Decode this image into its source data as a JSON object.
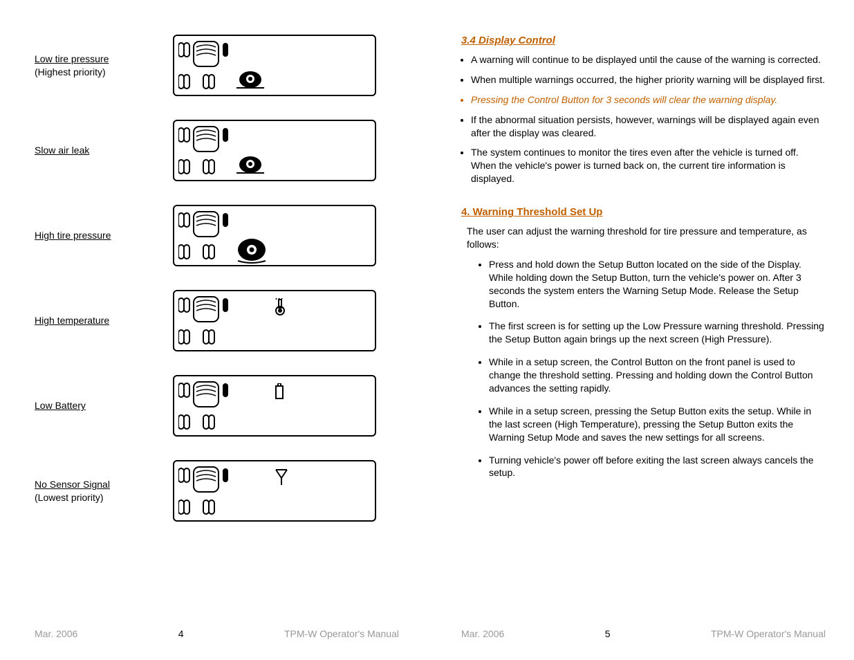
{
  "left_page": {
    "warnings": [
      {
        "title": "Low tire pressure",
        "sub": "(Highest priority)",
        "variant": "flat_tire"
      },
      {
        "title": "Slow air leak",
        "sub": "",
        "variant": "flat_tire"
      },
      {
        "title": "High tire pressure",
        "sub": "",
        "variant": "big_tire"
      },
      {
        "title": "High temperature",
        "sub": "",
        "variant": "thermometer"
      },
      {
        "title": "Low Battery",
        "sub": "",
        "variant": "battery"
      },
      {
        "title": "No Sensor Signal",
        "sub": "(Lowest priority)",
        "variant": "antenna"
      }
    ],
    "footer": {
      "date": "Mar. 2006",
      "page_num": "4",
      "manual": "TPM-W Operator's Manual"
    }
  },
  "right_page": {
    "section_34": {
      "heading": "3.4 Display Control",
      "bullets": [
        {
          "text": "A warning will continue to be displayed until the cause of the warning is corrected.",
          "style": "normal"
        },
        {
          "text": "When multiple warnings occurred, the higher priority warning will be displayed first.",
          "style": "normal"
        },
        {
          "text": "Pressing the Control Button for 3 seconds will clear the warning display.",
          "style": "orange_italic"
        },
        {
          "text": "If the abnormal situation persists, however, warnings will be displayed again even after the display was cleared.",
          "style": "normal"
        },
        {
          "text": "The system continues to monitor the tires even after the vehicle is turned off. When the vehicle's power is turned back on, the current tire information is displayed.",
          "style": "normal"
        }
      ]
    },
    "section_4": {
      "heading": "4. Warning Threshold Set Up",
      "intro": "The user can adjust the warning threshold for tire pressure and temperature, as follows:",
      "bullets": [
        "Press and hold down the Setup Button located on the side of the Display. While holding down the Setup Button, turn the vehicle's power on. After 3 seconds the system enters the Warning Setup Mode. Release the Setup Button.",
        "The first screen is for setting up the Low Pressure warning threshold. Pressing the Setup Button again brings up the next screen (High Pressure).",
        "While in a setup screen, the Control Button on the front panel is used to change the threshold setting. Pressing and holding down the Control Button advances the setting rapidly.",
        "While in a setup screen, pressing the Setup Button exits the setup. While in the last screen (High Temperature), pressing the Setup Button exits the Warning Setup Mode and saves the new settings for all screens.",
        "Turning vehicle's power off before exiting the last screen always cancels the setup."
      ]
    },
    "footer": {
      "date": "Mar. 2006",
      "page_num": "5",
      "manual": "TPM-W Operator's Manual"
    }
  }
}
